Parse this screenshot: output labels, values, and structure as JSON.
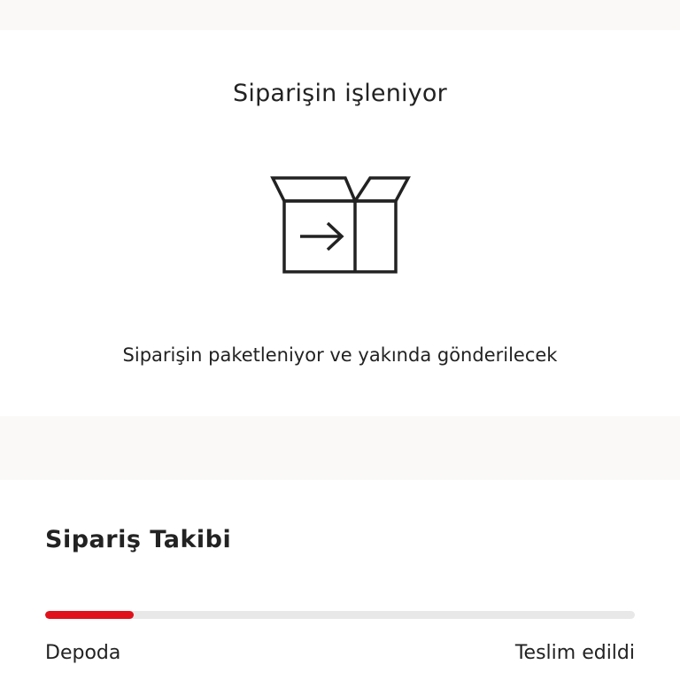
{
  "order_status": {
    "title": "Siparişin işleniyor",
    "icon": "package-box-arrow-icon",
    "description": "Siparişin paketleniyor ve yakında gönderilecek"
  },
  "tracking": {
    "title": "Sipariş Takibi",
    "progress_fraction": 0.15,
    "start_label": "Depoda",
    "end_label": "Teslim edildi",
    "colors": {
      "progress_fill": "#e0111b",
      "progress_track": "#e8e8e8"
    }
  }
}
